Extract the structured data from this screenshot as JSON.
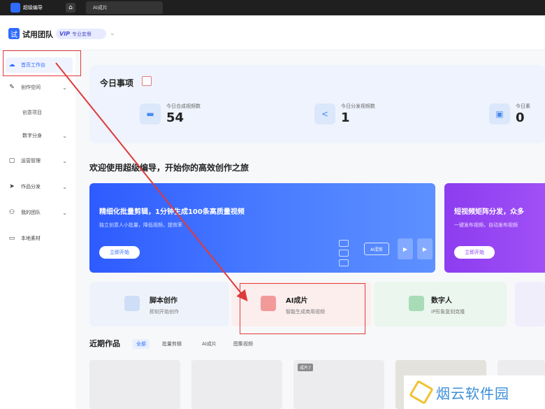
{
  "topbar": {
    "logo_text": "超级编导",
    "home_icon": "home-icon",
    "tab_label": "AI成片"
  },
  "header": {
    "team_badge": "试",
    "team_name": "试用团队",
    "vip_label": "VIP",
    "vip_plan": "专业套餐"
  },
  "sidebar": {
    "items": [
      {
        "label": "首页工作台",
        "icon": "cloud-icon",
        "active": true
      },
      {
        "label": "创作空间",
        "icon": "edit-icon"
      },
      {
        "label": "创意项目",
        "sub": true
      },
      {
        "label": "数字分身",
        "sub": true
      },
      {
        "label": "运营管理",
        "icon": "bag-icon"
      },
      {
        "label": "作品分发",
        "icon": "send-icon"
      },
      {
        "label": "我的团队",
        "icon": "team-icon"
      },
      {
        "label": "本地素材",
        "icon": "folder-icon"
      }
    ]
  },
  "today": {
    "title": "今日事项",
    "stats": [
      {
        "label": "今日合成视频数",
        "value": "54",
        "icon": "folder-icon"
      },
      {
        "label": "今日分发视频数",
        "value": "1",
        "icon": "share-icon"
      },
      {
        "label": "今日素",
        "value": "0",
        "icon": "box-icon"
      }
    ]
  },
  "welcome": "欢迎使用超级编导，开始你的高效创作之旅",
  "banners": [
    {
      "title": "精细化批量剪辑，1分钟生成100条高质量视频",
      "subtitle": "独立创意人小批量，降低视频，提效率",
      "button": "立即开始",
      "flow_label": "AI混剪"
    },
    {
      "title": "短视频矩阵分发，众多",
      "subtitle": "一键发布视频，自动发布视频",
      "button": "立即开始"
    }
  ],
  "quick_cards": [
    {
      "title": "脚本创作",
      "subtitle": "即刻开始创作",
      "icon": "doc-icon"
    },
    {
      "title": "AI成片",
      "subtitle": "智能生成商用视频",
      "icon": "ai-video-icon"
    },
    {
      "title": "数字人",
      "subtitle": "IP形象复刻克隆",
      "icon": "digital-human-icon"
    }
  ],
  "recent": {
    "title": "近期作品",
    "tabs": [
      "全部",
      "批量剪辑",
      "AI成片",
      "图集视频"
    ],
    "thumb_badge": "成片7"
  },
  "watermark": "烟云软件园",
  "colors": {
    "accent": "#2f6bff",
    "highlight": "#e03a3a",
    "banner_blue": "#3a68ff",
    "banner_purple": "#9545f2"
  }
}
